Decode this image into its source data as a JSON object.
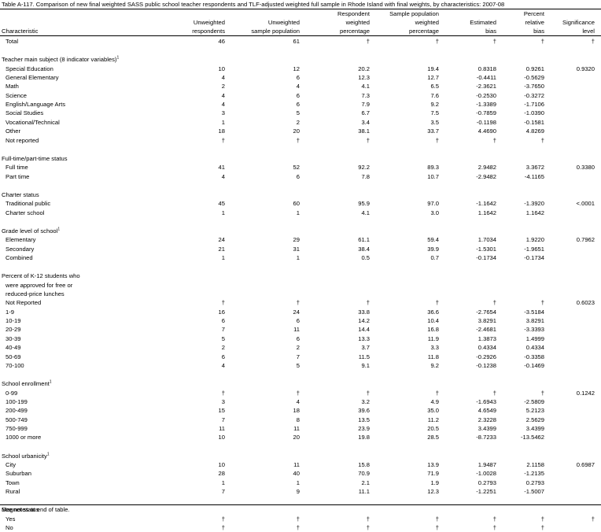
{
  "title": "Table A-117. Comparison of new final weighted SASS public school teacher respondents and TLF-adjusted weighted full sample in Rhode Island with final weights, by characteristics: 2007-08",
  "columns": [
    {
      "key": "char",
      "lines": [
        "Characteristic"
      ]
    },
    {
      "key": "ur",
      "lines": [
        "Unweighted",
        "respondents"
      ]
    },
    {
      "key": "usp",
      "lines": [
        "Unweighted",
        "sample population"
      ]
    },
    {
      "key": "rwp",
      "lines": [
        "Respondent",
        "weighted",
        "percentage"
      ]
    },
    {
      "key": "spwp",
      "lines": [
        "Sample population",
        "weighted",
        "percentage"
      ]
    },
    {
      "key": "eb",
      "lines": [
        "Estimated",
        "bias"
      ]
    },
    {
      "key": "prb",
      "lines": [
        "Percent",
        "relative",
        "bias"
      ]
    },
    {
      "key": "sl",
      "lines": [
        "Significance",
        "level"
      ]
    }
  ],
  "rows": [
    {
      "type": "data",
      "label": "Total",
      "v": [
        "46",
        "61",
        "†",
        "†",
        "†",
        "†",
        "†"
      ]
    },
    {
      "type": "section",
      "label": "Teacher main subject (8 indicator variables)",
      "sup": "1"
    },
    {
      "type": "data",
      "label": "Special Education",
      "v": [
        "10",
        "12",
        "20.2",
        "19.4",
        "0.8318",
        "0.9261",
        "0.9320"
      ]
    },
    {
      "type": "data",
      "label": "General Elementary",
      "v": [
        "4",
        "6",
        "12.3",
        "12.7",
        "-0.4411",
        "-0.5629",
        ""
      ]
    },
    {
      "type": "data",
      "label": "Math",
      "v": [
        "2",
        "4",
        "4.1",
        "6.5",
        "-2.3621",
        "-3.7650",
        ""
      ]
    },
    {
      "type": "data",
      "label": "Science",
      "v": [
        "4",
        "6",
        "7.3",
        "7.6",
        "-0.2530",
        "-0.3272",
        ""
      ]
    },
    {
      "type": "data",
      "label": "English/Language Arts",
      "v": [
        "4",
        "6",
        "7.9",
        "9.2",
        "-1.3389",
        "-1.7106",
        ""
      ]
    },
    {
      "type": "data",
      "label": "Social Studies",
      "v": [
        "3",
        "5",
        "6.7",
        "7.5",
        "-0.7859",
        "-1.0390",
        ""
      ]
    },
    {
      "type": "data",
      "label": "Vocational/Technical",
      "v": [
        "1",
        "2",
        "3.4",
        "3.5",
        "-0.1198",
        "-0.1581",
        ""
      ]
    },
    {
      "type": "data",
      "label": "Other",
      "v": [
        "18",
        "20",
        "38.1",
        "33.7",
        "4.4690",
        "4.8269",
        ""
      ]
    },
    {
      "type": "data",
      "label": "Not reported",
      "v": [
        "†",
        "†",
        "†",
        "†",
        "†",
        "†",
        ""
      ]
    },
    {
      "type": "section",
      "label": "Full-time/part-time status"
    },
    {
      "type": "data",
      "label": "Full time",
      "v": [
        "41",
        "52",
        "92.2",
        "89.3",
        "2.9482",
        "3.3672",
        "0.3380"
      ]
    },
    {
      "type": "data",
      "label": "Part time",
      "v": [
        "4",
        "6",
        "7.8",
        "10.7",
        "-2.9482",
        "-4.1165",
        ""
      ]
    },
    {
      "type": "section",
      "label": "Charter status"
    },
    {
      "type": "data",
      "label": "Traditional public",
      "v": [
        "45",
        "60",
        "95.9",
        "97.0",
        "-1.1642",
        "-1.3920",
        "<.0001"
      ]
    },
    {
      "type": "data",
      "label": "Charter school",
      "v": [
        "1",
        "1",
        "4.1",
        "3.0",
        "1.1642",
        "1.1642",
        ""
      ]
    },
    {
      "type": "section",
      "label": "Grade level of school",
      "sup": "1"
    },
    {
      "type": "data",
      "label": "Elementary",
      "v": [
        "24",
        "29",
        "61.1",
        "59.4",
        "1.7034",
        "1.9220",
        "0.7962"
      ]
    },
    {
      "type": "data",
      "label": "Secondary",
      "v": [
        "21",
        "31",
        "38.4",
        "39.9",
        "-1.5301",
        "-1.9651",
        ""
      ]
    },
    {
      "type": "data",
      "label": "Combined",
      "v": [
        "1",
        "1",
        "0.5",
        "0.7",
        "-0.1734",
        "-0.1734",
        ""
      ]
    },
    {
      "type": "section",
      "label": "Percent of K-12 students who"
    },
    {
      "type": "sub",
      "label": "were approved for free or"
    },
    {
      "type": "sub",
      "label": "reduced-price lunches"
    },
    {
      "type": "data",
      "label": "Not Reported",
      "v": [
        "†",
        "†",
        "†",
        "†",
        "†",
        "†",
        "0.6023"
      ]
    },
    {
      "type": "data",
      "label": "1-9",
      "v": [
        "16",
        "24",
        "33.8",
        "36.6",
        "-2.7654",
        "-3.5184",
        ""
      ]
    },
    {
      "type": "data",
      "label": "10-19",
      "v": [
        "6",
        "6",
        "14.2",
        "10.4",
        "3.8291",
        "3.8291",
        ""
      ]
    },
    {
      "type": "data",
      "label": "20-29",
      "v": [
        "7",
        "11",
        "14.4",
        "16.8",
        "-2.4681",
        "-3.3393",
        ""
      ]
    },
    {
      "type": "data",
      "label": "30-39",
      "v": [
        "5",
        "6",
        "13.3",
        "11.9",
        "1.3873",
        "1.4999",
        ""
      ]
    },
    {
      "type": "data",
      "label": "40-49",
      "v": [
        "2",
        "2",
        "3.7",
        "3.3",
        "0.4334",
        "0.4334",
        ""
      ]
    },
    {
      "type": "data",
      "label": "50-69",
      "v": [
        "6",
        "7",
        "11.5",
        "11.8",
        "-0.2926",
        "-0.3358",
        ""
      ]
    },
    {
      "type": "data",
      "label": "70-100",
      "v": [
        "4",
        "5",
        "9.1",
        "9.2",
        "-0.1238",
        "-0.1469",
        ""
      ]
    },
    {
      "type": "section",
      "label": "School enrollment",
      "sup": "1"
    },
    {
      "type": "data",
      "label": "0-99",
      "v": [
        "†",
        "†",
        "†",
        "†",
        "†",
        "†",
        "0.1242"
      ]
    },
    {
      "type": "data",
      "label": "100-199",
      "v": [
        "3",
        "4",
        "3.2",
        "4.9",
        "-1.6943",
        "-2.5809",
        ""
      ]
    },
    {
      "type": "data",
      "label": "200-499",
      "v": [
        "15",
        "18",
        "39.6",
        "35.0",
        "4.6549",
        "5.2123",
        ""
      ]
    },
    {
      "type": "data",
      "label": "500-749",
      "v": [
        "7",
        "8",
        "13.5",
        "11.2",
        "2.3228",
        "2.5629",
        ""
      ]
    },
    {
      "type": "data",
      "label": "750-999",
      "v": [
        "11",
        "11",
        "23.9",
        "20.5",
        "3.4399",
        "3.4399",
        ""
      ]
    },
    {
      "type": "data",
      "label": "1000 or more",
      "v": [
        "10",
        "20",
        "19.8",
        "28.5",
        "-8.7233",
        "-13.5462",
        ""
      ]
    },
    {
      "type": "section",
      "label": "School urbanicity",
      "sup": "1"
    },
    {
      "type": "data",
      "label": "City",
      "v": [
        "10",
        "11",
        "15.8",
        "13.9",
        "1.9487",
        "2.1158",
        "0.6987"
      ]
    },
    {
      "type": "data",
      "label": "Suburban",
      "v": [
        "28",
        "40",
        "70.9",
        "71.9",
        "-1.0028",
        "-1.2135",
        ""
      ]
    },
    {
      "type": "data",
      "label": "Town",
      "v": [
        "1",
        "1",
        "2.1",
        "1.9",
        "0.2793",
        "0.2793",
        ""
      ]
    },
    {
      "type": "data",
      "label": "Rural",
      "v": [
        "7",
        "9",
        "11.1",
        "12.3",
        "-1.2251",
        "-1.5007",
        ""
      ]
    },
    {
      "type": "section",
      "label": "Magnet status"
    },
    {
      "type": "data",
      "label": "Yes",
      "v": [
        "†",
        "†",
        "†",
        "†",
        "†",
        "†",
        "†"
      ]
    },
    {
      "type": "data",
      "label": "No",
      "v": [
        "†",
        "†",
        "†",
        "†",
        "†",
        "†",
        ""
      ]
    }
  ],
  "footer": "See notes at end of table."
}
